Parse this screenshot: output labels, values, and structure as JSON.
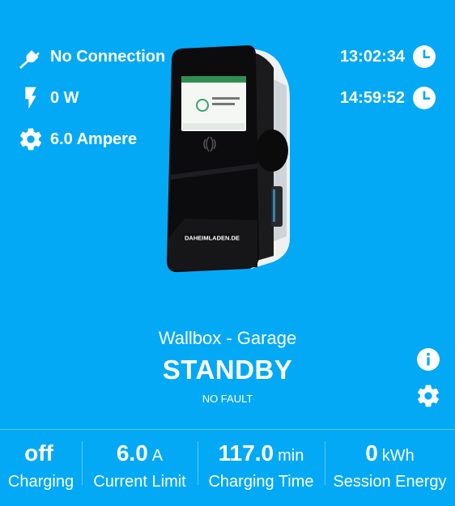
{
  "status_left": {
    "connection": {
      "text": "No Connection",
      "icon": "ev-plug-icon"
    },
    "power": {
      "text": "0 W",
      "icon": "flash-icon"
    },
    "current": {
      "text": "6.0 Ampere",
      "icon": "gear-icon"
    }
  },
  "status_right": {
    "time1": {
      "text": "13:02:34",
      "icon": "clock-icon"
    },
    "time2": {
      "text": "14:59:52",
      "icon": "clock-icon"
    }
  },
  "device": {
    "brand_text": "DAHEIMLADEN.DE",
    "screen_text": "Bitte Ladekabel anstecken"
  },
  "wallbox": {
    "name": "Wallbox - Garage",
    "state": "STANDBY",
    "fault": "NO FAULT"
  },
  "bottom": [
    {
      "value": "off",
      "unit": "",
      "label": "Charging"
    },
    {
      "value": "6.0",
      "unit": "A",
      "label": "Current Limit"
    },
    {
      "value": "117.0",
      "unit": "min",
      "label": "Charging Time"
    },
    {
      "value": "0",
      "unit": "kWh",
      "label": "Session Energy"
    }
  ],
  "colors": {
    "background": "#03A9F4",
    "text": "#ffffff"
  }
}
